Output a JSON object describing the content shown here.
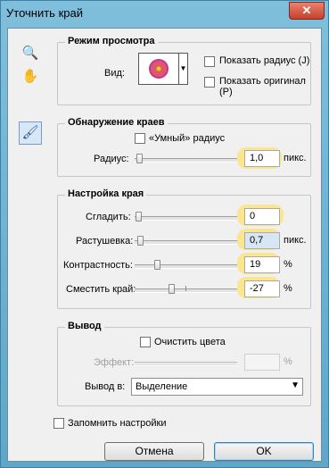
{
  "window": {
    "title": "Уточнить край",
    "close_glyph": "✕"
  },
  "tools": {
    "zoom_icon": "🔍",
    "hand_icon": "✋",
    "brush_icon": "🖌"
  },
  "view_mode": {
    "legend": "Режим просмотра",
    "view_label": "Вид:",
    "show_radius": "Показать радиус (J)",
    "show_original": "Показать оригинал (P)"
  },
  "edge_detection": {
    "legend": "Обнаружение краев",
    "smart_radius": "«Умный» радиус",
    "radius_label": "Радиус:",
    "radius_value": "1,0",
    "radius_unit": "пикс."
  },
  "adjust_edge": {
    "legend": "Настройка края",
    "smooth_label": "Сгладить:",
    "smooth_value": "0",
    "feather_label": "Растушевка:",
    "feather_value": "0,7",
    "feather_unit": "пикс.",
    "contrast_label": "Контрастность:",
    "contrast_value": "19",
    "contrast_unit": "%",
    "shift_label": "Сместить край:",
    "shift_value": "-27",
    "shift_unit": "%"
  },
  "output": {
    "legend": "Вывод",
    "decontaminate": "Очистить цвета",
    "amount_label": "Эффект:",
    "amount_unit": "%",
    "output_to_label": "Вывод в:",
    "output_to_value": "Выделение"
  },
  "remember": "Запомнить настройки",
  "buttons": {
    "cancel": "Отмена",
    "ok": "OK"
  }
}
